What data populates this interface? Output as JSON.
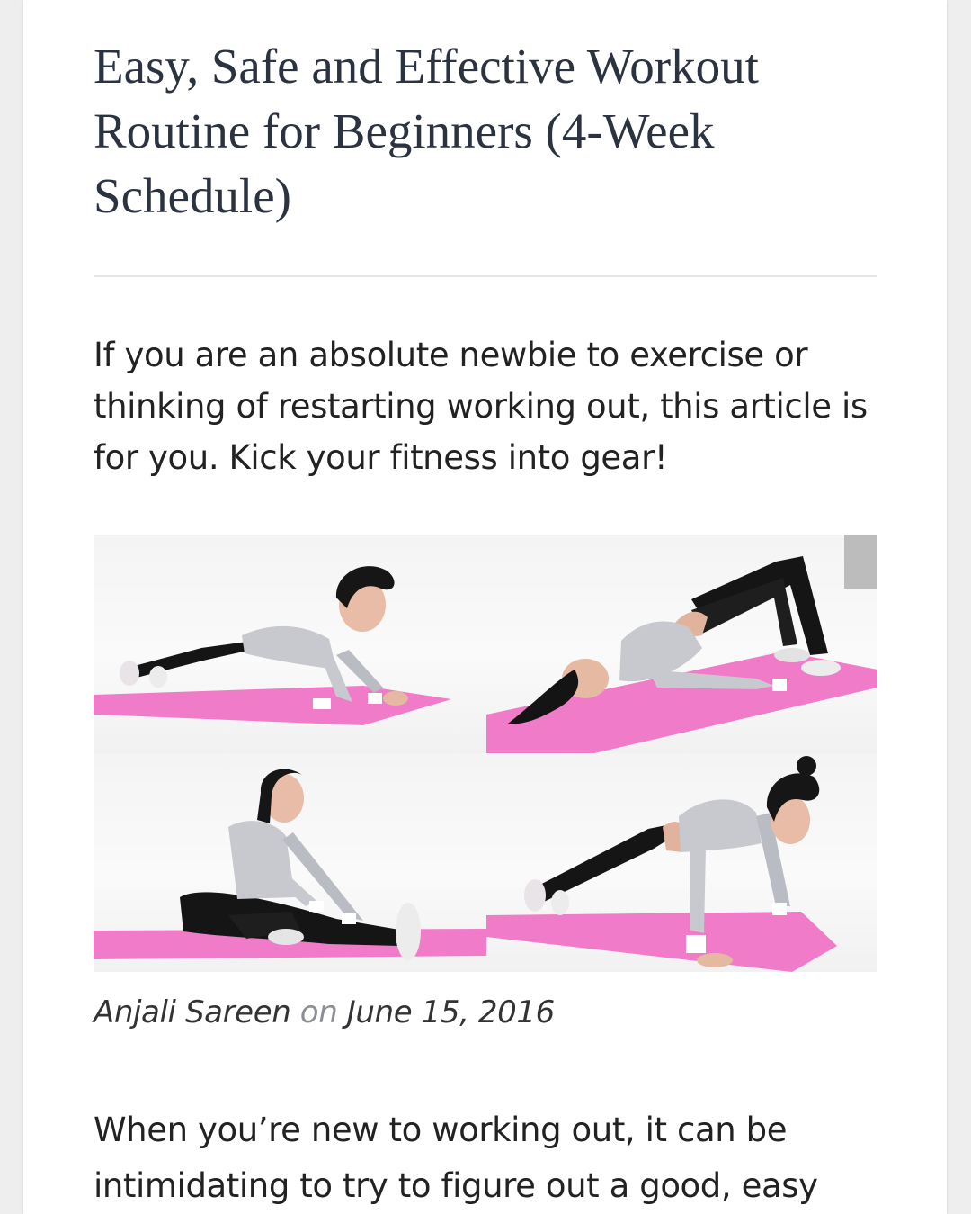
{
  "article": {
    "title": "Easy, Safe and Effective Workout Routine for Beginners (4-Week Schedule)",
    "intro": "If you are an absolute newbie to exercise or thinking of restarting working out, this article is for you. Kick your fitness into gear!",
    "author": "Anjali Sareen",
    "byline_connector": "on",
    "date": "June 15, 2016",
    "body_start": "When you’re new to working out, it can be intimidating to try to figure out a good, easy"
  },
  "hero_image": {
    "panels": [
      "plank-exercise",
      "glute-bridge-exercise",
      "seated-hamstring-stretch",
      "push-up-exercise"
    ]
  },
  "colors": {
    "mat": "#f07bc8",
    "title": "#2b3340",
    "text": "#222222",
    "muted": "#8b8f95"
  }
}
